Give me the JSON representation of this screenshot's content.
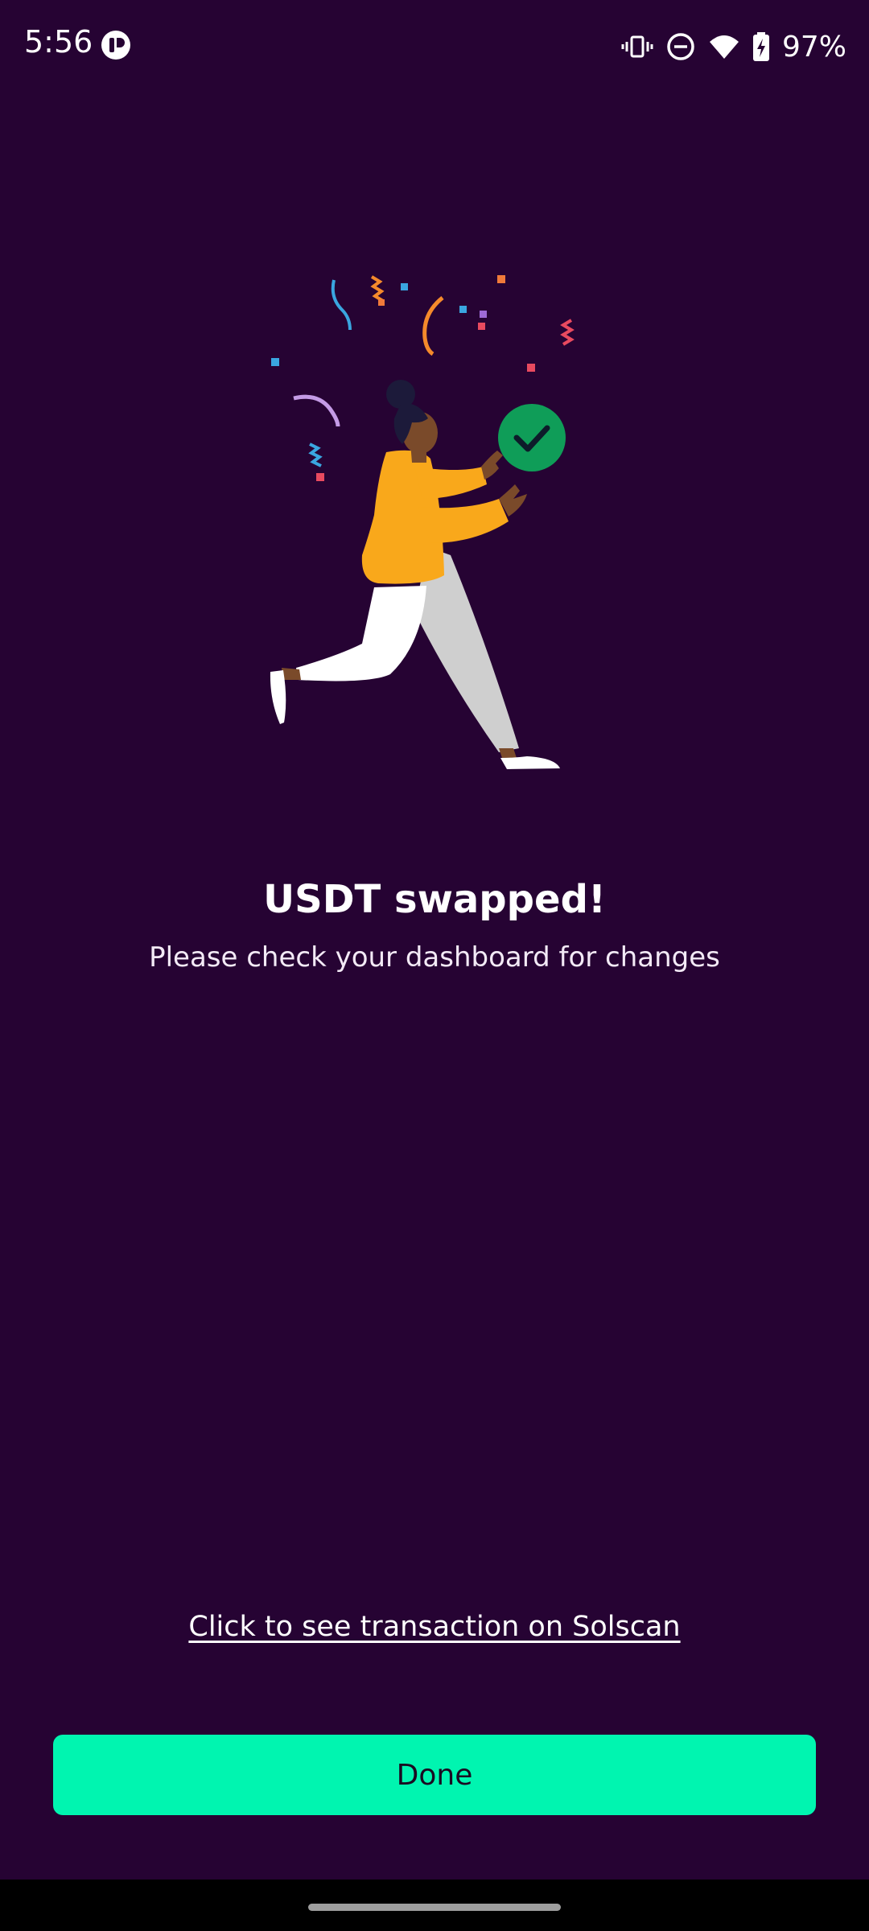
{
  "status_bar": {
    "time": "5:56",
    "battery_percent": "97%",
    "icons": [
      "app-logo-icon",
      "vibrate-icon",
      "do-not-disturb-icon",
      "wifi-icon",
      "battery-charging-icon"
    ]
  },
  "success": {
    "title": "USDT swapped!",
    "subtitle": "Please check your dashboard for changes"
  },
  "link": {
    "solscan_label": "Click to see transaction on Solscan"
  },
  "actions": {
    "done_label": "Done"
  },
  "colors": {
    "background": "#260333",
    "accent": "#00f5b0",
    "check_badge": "#0f9d58",
    "sweater": "#f9a81b"
  }
}
